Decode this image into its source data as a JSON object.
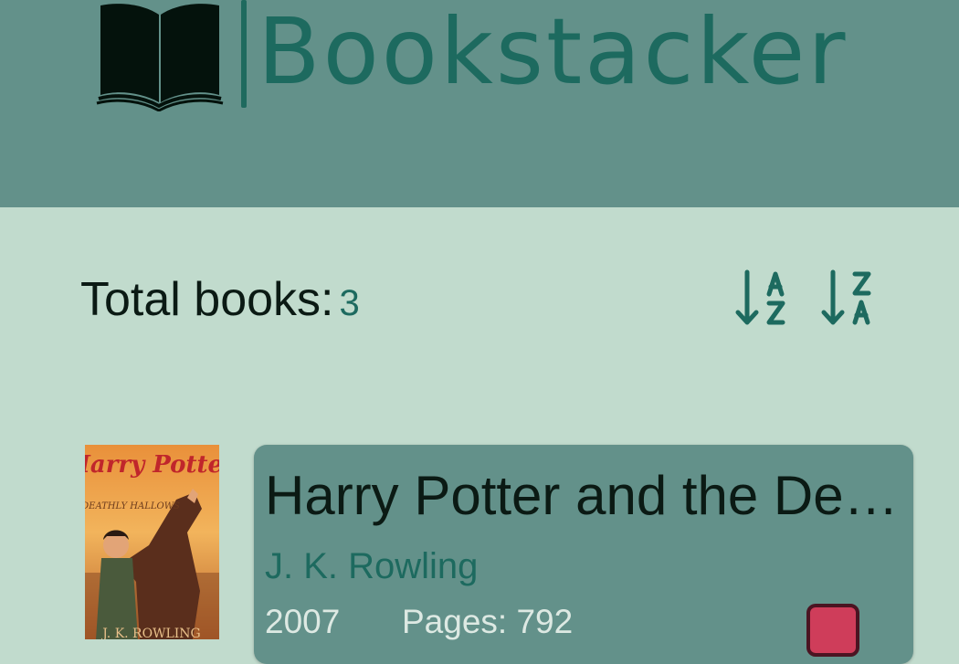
{
  "app": {
    "name": "Bookstacker"
  },
  "summary": {
    "total_label": "Total books:",
    "total_count": "3"
  },
  "sort": {
    "ascending_icon": "sort-a-z-icon",
    "descending_icon": "sort-z-a-icon"
  },
  "books": [
    {
      "title": "Harry Potter and the Deathly Hallows",
      "author": "J. K. Rowling",
      "year": "2007",
      "pages": "Pages: 792",
      "cover_title": "Harry Potter",
      "cover_subtitle": "DEATHLY HALLOWS",
      "cover_author": "J. K. ROWLING",
      "badge_color": "#cf3d5a"
    }
  ],
  "colors": {
    "header_bg": "#63918a",
    "page_bg": "#c1dbcd",
    "accent": "#1d6a5f",
    "card_bg": "#63918a",
    "badge": "#cf3d5a"
  }
}
